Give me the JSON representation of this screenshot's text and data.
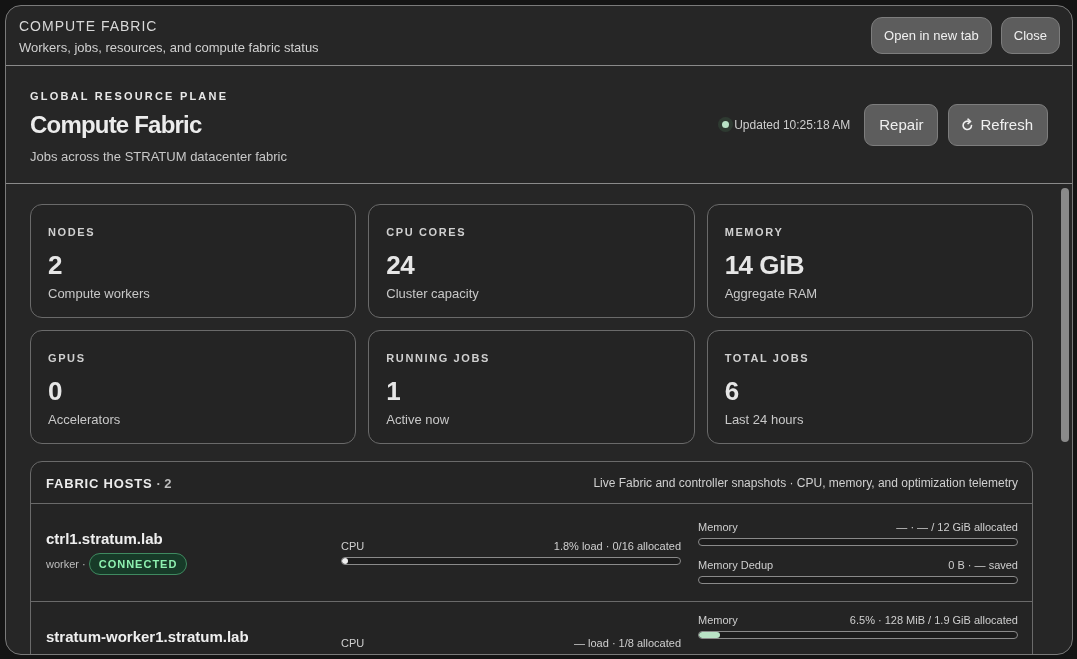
{
  "window": {
    "title": "COMPUTE FABRIC",
    "subtitle": "Workers, jobs, resources, and compute fabric status",
    "buttons": [
      "Open in new tab",
      "Close"
    ]
  },
  "hero": {
    "eyebrow": "GLOBAL RESOURCE PLANE",
    "title": "Compute Fabric",
    "subtitle": "Jobs across the STRATUM datacenter fabric",
    "status": {
      "text": "Updated 10:25:18 AM",
      "color": "#b9e3c6"
    },
    "actions": [
      {
        "label": "Repair",
        "kind": "plain"
      },
      {
        "label": "Refresh",
        "kind": "refresh"
      }
    ]
  },
  "stats": [
    {
      "label": "NODES",
      "value": "2",
      "caption": "Compute workers"
    },
    {
      "label": "CPU CORES",
      "value": "24",
      "caption": "Cluster capacity"
    },
    {
      "label": "MEMORY",
      "value": "14 GiB",
      "caption": "Aggregate RAM"
    },
    {
      "label": "GPUS",
      "value": "0",
      "caption": "Accelerators"
    },
    {
      "label": "RUNNING JOBS",
      "value": "1",
      "caption": "Active now"
    },
    {
      "label": "TOTAL JOBS",
      "value": "6",
      "caption": "Last 24 hours"
    }
  ],
  "hosts": {
    "title": "FABRIC HOSTS",
    "count": "· 2",
    "description": "Live Fabric and controller snapshots · CPU, memory, and optimization telemetry",
    "rows": [
      {
        "name": "ctrl1.stratum.lab",
        "role": "worker ·",
        "status": "CONNECTED",
        "cpu": {
          "label": "CPU",
          "reading": "1.8% load · 0/16 allocated",
          "level": 0.018
        },
        "memory": {
          "label": "Memory",
          "reading": "— · — / 12 GiB allocated",
          "level": 0
        },
        "dedup": {
          "label": "Memory Dedup",
          "reading": "0 B · — saved",
          "level": 0
        }
      },
      {
        "name": "stratum-worker1.stratum.lab",
        "cpu": {
          "label": "CPU",
          "reading": "— load · 1/8 allocated"
        },
        "memory": {
          "label": "Memory",
          "reading": "6.5% · 128 MiB / 1.9 GiB allocated",
          "level": 0.065
        }
      }
    ]
  }
}
